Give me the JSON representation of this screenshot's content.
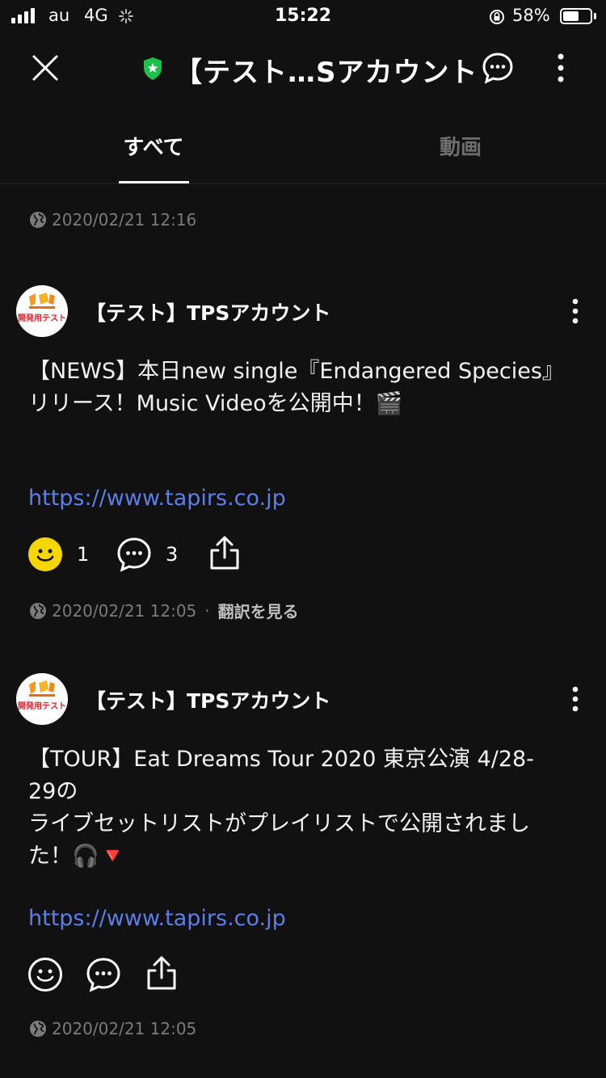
{
  "status_bar": {
    "carrier": "au",
    "network": "4G",
    "time": "15:22",
    "battery": "58%"
  },
  "header": {
    "title": "【テスト…Sアカウント",
    "close_icon": "close-icon",
    "verified_icon": "shield-star-icon",
    "chat_icon": "chat-bubble-icon",
    "more_icon": "vertical-ellipsis-icon"
  },
  "tabs": [
    {
      "label": "すべて",
      "selected": true
    },
    {
      "label": "動画",
      "selected": false
    }
  ],
  "top_meta": {
    "timestamp": "2020/02/21 12:16"
  },
  "posts": [
    {
      "author": "【テスト】TPSアカウント",
      "avatar_text": "開発用テスト",
      "text": "【NEWS】本日new single『Endangered Species』\nリリース！Music Videoを公開中！🎬",
      "link": "https://www.tapirs.co.jp",
      "reaction_count": "1",
      "comment_count": "3",
      "timestamp": "2020/02/21 12:05",
      "translate": "翻訳を見る"
    },
    {
      "author": "【テスト】TPSアカウント",
      "avatar_text": "開発用テスト",
      "text": "【TOUR】Eat Dreams Tour 2020 東京公演 4/28-29の\nライブセットリストがプレイリストで公開されました！🎧🔻",
      "link": "https://www.tapirs.co.jp",
      "timestamp": "2020/02/21 12:05"
    }
  ],
  "colors": {
    "background": "#111111",
    "link": "#5b7ee8",
    "reaction_active": "#f5d600",
    "verified": "#1fbf4b",
    "meta": "#7b7b7b"
  }
}
